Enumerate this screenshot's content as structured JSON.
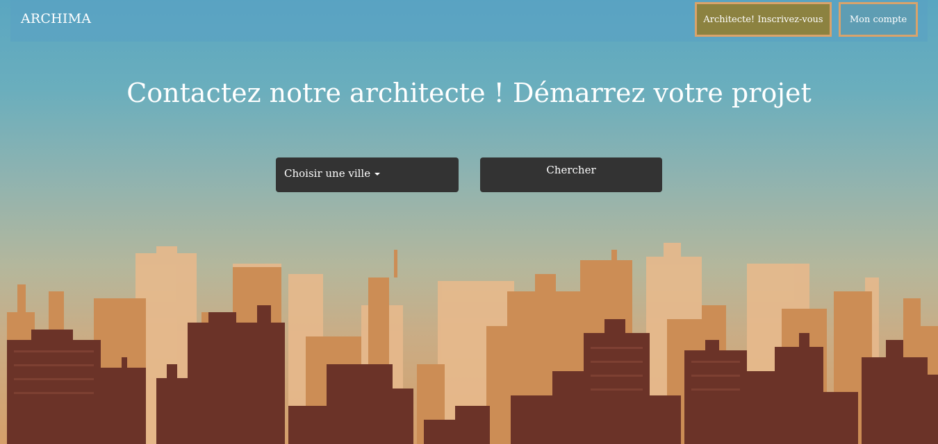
{
  "nav": {
    "brand": "ARCHIMA",
    "register_label": "Architecte! Inscrivez-vous",
    "account_label": "Mon compte"
  },
  "hero": {
    "title": "Contactez notre architecte ! Démarrez votre projet",
    "city_select_label": "Choisir une ville",
    "search_label": "Chercher"
  },
  "colors": {
    "register_button": "#8c8240",
    "button_border": "#d9a36b",
    "control_background": "#333333"
  }
}
